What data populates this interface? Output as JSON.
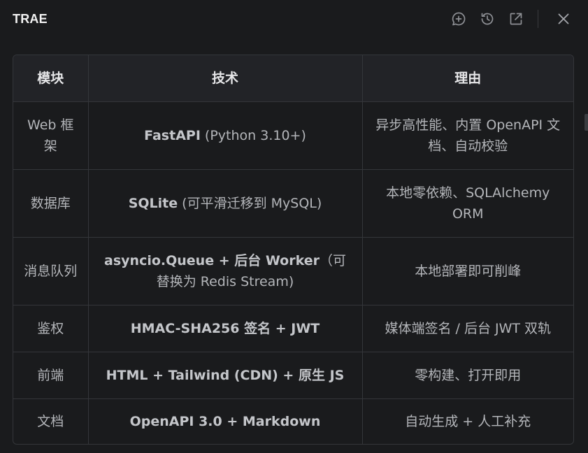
{
  "app": {
    "title": "TRAE"
  },
  "toolbar": {
    "new_chat_icon": "chat-plus-icon",
    "history_icon": "history-icon",
    "open_external_icon": "external-link-icon",
    "close_icon": "close-icon"
  },
  "table": {
    "headers": [
      "模块",
      "技术",
      "理由"
    ],
    "rows": [
      {
        "module": "Web 框架",
        "tech": [
          {
            "text": "FastAPI",
            "bold": true
          },
          {
            "text": " (Python 3.10+)",
            "bold": false
          }
        ],
        "reason": "异步高性能、内置 OpenAPI 文档、自动校验"
      },
      {
        "module": "数据库",
        "tech": [
          {
            "text": "SQLite",
            "bold": true
          },
          {
            "text": " (可平滑迁移到 MySQL)",
            "bold": false
          }
        ],
        "reason": "本地零依赖、SQLAlchemy ORM"
      },
      {
        "module": "消息队列",
        "tech": [
          {
            "text": "asyncio.Queue + 后台 Worker",
            "bold": true
          },
          {
            "text": "（可替换为 Redis Stream)",
            "bold": false
          }
        ],
        "reason": "本地部署即可削峰"
      },
      {
        "module": "鉴权",
        "tech": [
          {
            "text": "HMAC-SHA256 签名 + JWT",
            "bold": true
          }
        ],
        "reason": "媒体端签名 / 后台 JWT 双轨"
      },
      {
        "module": "前端",
        "tech": [
          {
            "text": "HTML + Tailwind (CDN) + 原生 JS",
            "bold": true
          }
        ],
        "reason": "零构建、打开即用"
      },
      {
        "module": "文档",
        "tech": [
          {
            "text": "OpenAPI 3.0 + Markdown",
            "bold": true
          }
        ],
        "reason": "自动生成 + 人工补充"
      }
    ]
  },
  "colors": {
    "background": "#1a1b1d",
    "header_row": "#222327",
    "border": "#34363a",
    "title_text": "#f2f2f2",
    "body_text": "#b4b6ba"
  }
}
